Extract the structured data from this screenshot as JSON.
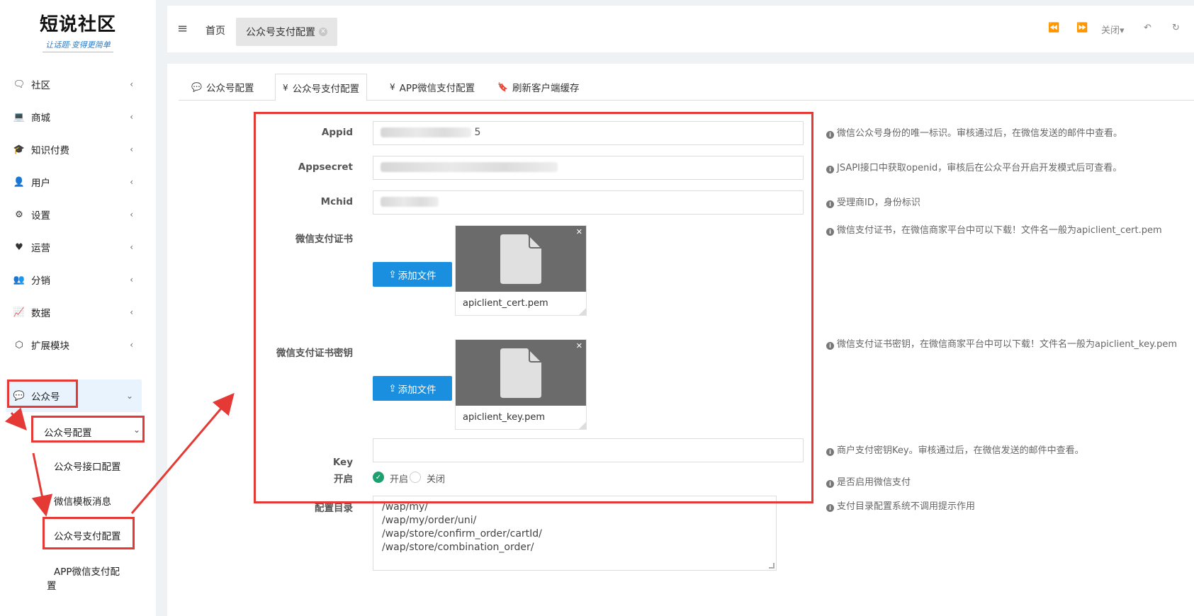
{
  "logo": {
    "title": "短说社区",
    "subtitle": "让话题·变得更简单"
  },
  "sidebar": {
    "items": [
      {
        "label": "社区",
        "icon": "comments-icon",
        "glyph": "🗨"
      },
      {
        "label": "商城",
        "icon": "laptop-icon",
        "glyph": "💻"
      },
      {
        "label": "知识付费",
        "icon": "graduation-cap-icon",
        "glyph": "🎓"
      },
      {
        "label": "用户",
        "icon": "user-icon",
        "glyph": "👤"
      },
      {
        "label": "设置",
        "icon": "gear-icon",
        "glyph": "⚙"
      },
      {
        "label": "运营",
        "icon": "heartbeat-icon",
        "glyph": "♥"
      },
      {
        "label": "分销",
        "icon": "users-icon",
        "glyph": "👥"
      },
      {
        "label": "数据",
        "icon": "line-chart-icon",
        "glyph": "📈"
      },
      {
        "label": "扩展模块",
        "icon": "puzzle-icon",
        "glyph": "⬡"
      },
      {
        "label": "公众号",
        "icon": "wechat-icon",
        "glyph": "💬"
      }
    ],
    "sub_config": "公众号配置",
    "sub_items": [
      "公众号接口配置",
      "微信模板消息",
      "公众号支付配置"
    ],
    "sub_item_app_line1": "APP微信支付配",
    "sub_item_app_line2": "置"
  },
  "topbar": {
    "menu_glyph": "≡",
    "home_tab": "首页",
    "active_tab": "公众号支付配置",
    "close_label": "关闭"
  },
  "config_tabs": [
    {
      "label": "公众号配置",
      "glyph": "💬"
    },
    {
      "label": "公众号支付配置",
      "glyph": "¥"
    },
    {
      "label": "APP微信支付配置",
      "glyph": "¥"
    },
    {
      "label": "刷新客户端缓存",
      "glyph": "🔖"
    }
  ],
  "form": {
    "appid": {
      "label": "Appid",
      "visible_value": "5",
      "help": "微信公众号身份的唯一标识。审核通过后，在微信发送的邮件中查看。"
    },
    "appsecret": {
      "label": "Appsecret",
      "help": "JSAPI接口中获取openid，审核后在公众平台开启开发模式后可查看。"
    },
    "mchid": {
      "label": "Mchid",
      "help": "受理商ID，身份标识"
    },
    "cert": {
      "label": "微信支付证书",
      "button": "添加文件",
      "file_name": "apiclient_cert.pem",
      "help": "微信支付证书，在微信商家平台中可以下载！文件名一般为apiclient_cert.pem"
    },
    "cert_key": {
      "label": "微信支付证书密钥",
      "button": "添加文件",
      "file_name": "apiclient_key.pem",
      "help": "微信支付证书密钥，在微信商家平台中可以下载！文件名一般为apiclient_key.pem"
    },
    "key": {
      "label": "Key",
      "value": "",
      "help": "商户支付密钥Key。审核通过后，在微信发送的邮件中查看。"
    },
    "enable": {
      "label": "开启",
      "on": "开启",
      "off": "关闭",
      "selected": "开启",
      "help": "是否启用微信支付"
    },
    "dirs": {
      "label": "配置目录",
      "lines": [
        "/wap/my/",
        "/wap/my/order/uni/",
        "/wap/store/confirm_order/cartId/",
        "/wap/store/combination_order/"
      ],
      "help": "支付目录配置系统不调用提示作用"
    }
  },
  "colors": {
    "accent": "#1a8fe0",
    "annotation_red": "#e53935",
    "check_green": "#1e9f6e",
    "sidebar_active": "#e8f3fd"
  }
}
